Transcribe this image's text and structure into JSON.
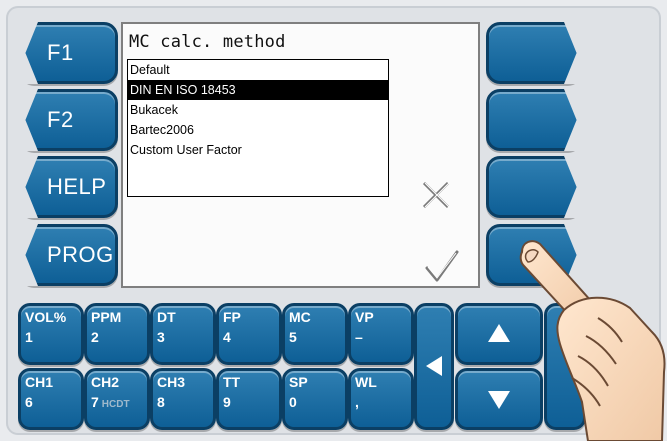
{
  "screen": {
    "title": "MC calc. method",
    "items": [
      {
        "label": "Default"
      },
      {
        "label": "DIN EN ISO 18453"
      },
      {
        "label": "Bukacek"
      },
      {
        "label": "Bartec2006"
      },
      {
        "label": "Custom User Factor"
      }
    ],
    "selected_index": 1
  },
  "left_keys": [
    {
      "label": "F1"
    },
    {
      "label": "F2"
    },
    {
      "label": "HELP"
    },
    {
      "label": "PROG"
    }
  ],
  "keypad": {
    "row1": [
      {
        "top": "VOL%",
        "bottom": "1"
      },
      {
        "top": "PPM",
        "bottom": "2"
      },
      {
        "top": "DT",
        "bottom": "3"
      },
      {
        "top": "FP",
        "bottom": "4"
      },
      {
        "top": "MC",
        "bottom": "5"
      },
      {
        "top": "VP",
        "bottom": "–"
      }
    ],
    "row2": [
      {
        "top": "CH1",
        "bottom": "6"
      },
      {
        "top": "CH2",
        "bottom": "7",
        "extra": "HCDT"
      },
      {
        "top": "CH3",
        "bottom": "8"
      },
      {
        "top": "TT",
        "bottom": "9"
      },
      {
        "top": "SP",
        "bottom": "0"
      },
      {
        "top": "WL",
        "bottom": ","
      }
    ]
  },
  "icons": {
    "cancel": "close-x-icon",
    "confirm": "checkmark-icon",
    "up": "arrow-up-icon",
    "down": "arrow-down-icon",
    "left": "arrow-left-icon",
    "finger": "pointing-hand-illustration"
  },
  "colors": {
    "key_blue": "#0e5f96",
    "key_border": "#0b3f64",
    "selected_bg": "#000000"
  }
}
